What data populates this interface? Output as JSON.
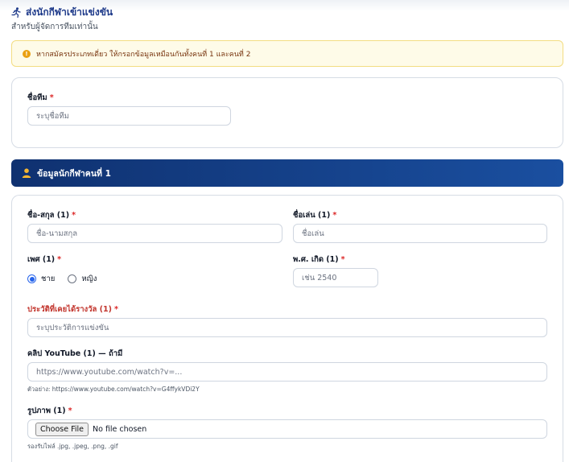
{
  "header": {
    "title": "ส่งนักกีฬาเข้าแข่งขัน",
    "subtitle": "สำหรับผู้จัดการทีมเท่านั้น",
    "icon": "running-person-icon"
  },
  "alert": {
    "icon": "info-icon",
    "text": "หากสมัครประเภทเดี่ยว ให้กรอกข้อมูลเหมือนกันทั้งคนที่ 1 และคนที่ 2"
  },
  "team": {
    "name_label": "ชื่อทีม",
    "name_placeholder": "ระบุชื่อทีม"
  },
  "player": {
    "section_title": "ข้อมูลนักกีฬาคนที่ 1",
    "section_icon": "user-icon",
    "fullname_label": "ชื่อ-สกุล (1)",
    "fullname_placeholder": "ชื่อ-นามสกุล",
    "nickname_label": "ชื่อเล่น (1)",
    "nickname_placeholder": "ชื่อเล่น",
    "gender_label": "เพศ (1)",
    "gender_options": [
      "ชาย",
      "หญิง"
    ],
    "gender_selected": "ชาย",
    "birthyear_label": "พ.ศ. เกิด (1)",
    "birthyear_placeholder": "เช่น 2540",
    "awards_label": "ประวัติที่เคยได้รางวัล (1)",
    "awards_placeholder": "ระบุประวัติการแข่งขัน",
    "youtube_label": "คลิป YouTube (1) — ถ้ามี",
    "youtube_placeholder": "https://www.youtube.com/watch?v=...",
    "youtube_hint": "ตัวอย่าง: https://www.youtube.com/watch?v=G4ffykVDi2Y",
    "photo_label": "รูปภาพ (1)",
    "photo_button": "Choose File",
    "photo_status": "No file chosen",
    "photo_hint": "รองรับไฟล์ .jpg, .jpeg, .png, .gif"
  },
  "required_mark": "*",
  "colors": {
    "primary": "#1e3a8a",
    "banner_start": "#0f3170",
    "banner_end": "#1a4fa0",
    "required": "#dc2626",
    "alert_bg": "#fefbe8",
    "alert_border": "#f3dd82",
    "warning_icon": "#eaa012",
    "radio_accent": "#2563eb"
  }
}
